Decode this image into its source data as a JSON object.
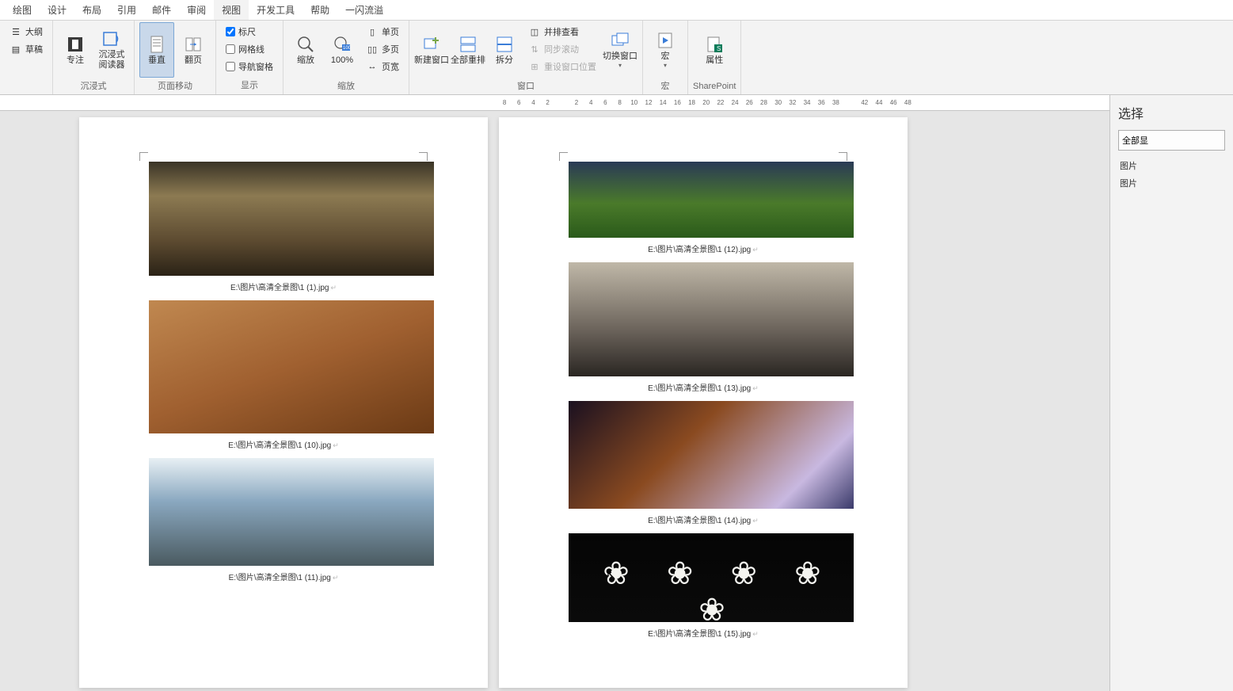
{
  "menu": {
    "items": [
      "绘图",
      "设计",
      "布局",
      "引用",
      "邮件",
      "审阅",
      "视图",
      "开发工具",
      "帮助",
      "一闪流溢"
    ],
    "active_index": 6
  },
  "ribbon": {
    "views_group": {
      "outline": "大纲",
      "draft": "草稿",
      "focus": "专注",
      "immersive_reader": "沉浸式\n阅读器",
      "label": "沉浸式"
    },
    "page_move_group": {
      "vertical": "垂直",
      "flip": "翻页",
      "label": "页面移动"
    },
    "show_group": {
      "ruler": "标尺",
      "gridlines": "网格线",
      "nav_pane": "导航窗格",
      "label": "显示",
      "ruler_checked": true,
      "gridlines_checked": false,
      "nav_checked": false
    },
    "zoom_group": {
      "zoom": "缩放",
      "hundred": "100%",
      "one_page": "单页",
      "multi_page": "多页",
      "page_width": "页宽",
      "label": "缩放"
    },
    "window_group": {
      "new_window": "新建窗口",
      "arrange_all": "全部重排",
      "split": "拆分",
      "side_by_side": "并排查看",
      "sync_scroll": "同步滚动",
      "reset_pos": "重设窗口位置",
      "switch_window": "切换窗口",
      "label": "窗口"
    },
    "macros_group": {
      "macros": "宏",
      "label": "宏"
    },
    "sharepoint_group": {
      "properties": "属性",
      "label": "SharePoint"
    }
  },
  "ruler_numbers": [
    "8",
    "6",
    "4",
    "2",
    "",
    "2",
    "4",
    "6",
    "8",
    "10",
    "12",
    "14",
    "16",
    "18",
    "20",
    "22",
    "24",
    "26",
    "28",
    "30",
    "32",
    "34",
    "36",
    "38",
    "",
    "42",
    "44",
    "46",
    "48"
  ],
  "pages": {
    "left": [
      {
        "caption": "E:\\图片\\高清全景图\\1 (1).jpg",
        "ph": "ph1"
      },
      {
        "caption": "E:\\图片\\高清全景图\\1 (10).jpg",
        "ph": "ph2"
      },
      {
        "caption": "E:\\图片\\高清全景图\\1 (11).jpg",
        "ph": "ph3"
      }
    ],
    "right": [
      {
        "caption": "E:\\图片\\高清全景图\\1 (12).jpg",
        "ph": "ph4"
      },
      {
        "caption": "E:\\图片\\高清全景图\\1 (13).jpg",
        "ph": "ph5"
      },
      {
        "caption": "E:\\图片\\高清全景图\\1 (14).jpg",
        "ph": "ph6"
      },
      {
        "caption": "E:\\图片\\高清全景图\\1 (15).jpg",
        "ph": "ph7"
      }
    ]
  },
  "right_panel": {
    "title": "选择",
    "show_all": "全部显",
    "items": [
      "图片",
      "图片"
    ]
  }
}
